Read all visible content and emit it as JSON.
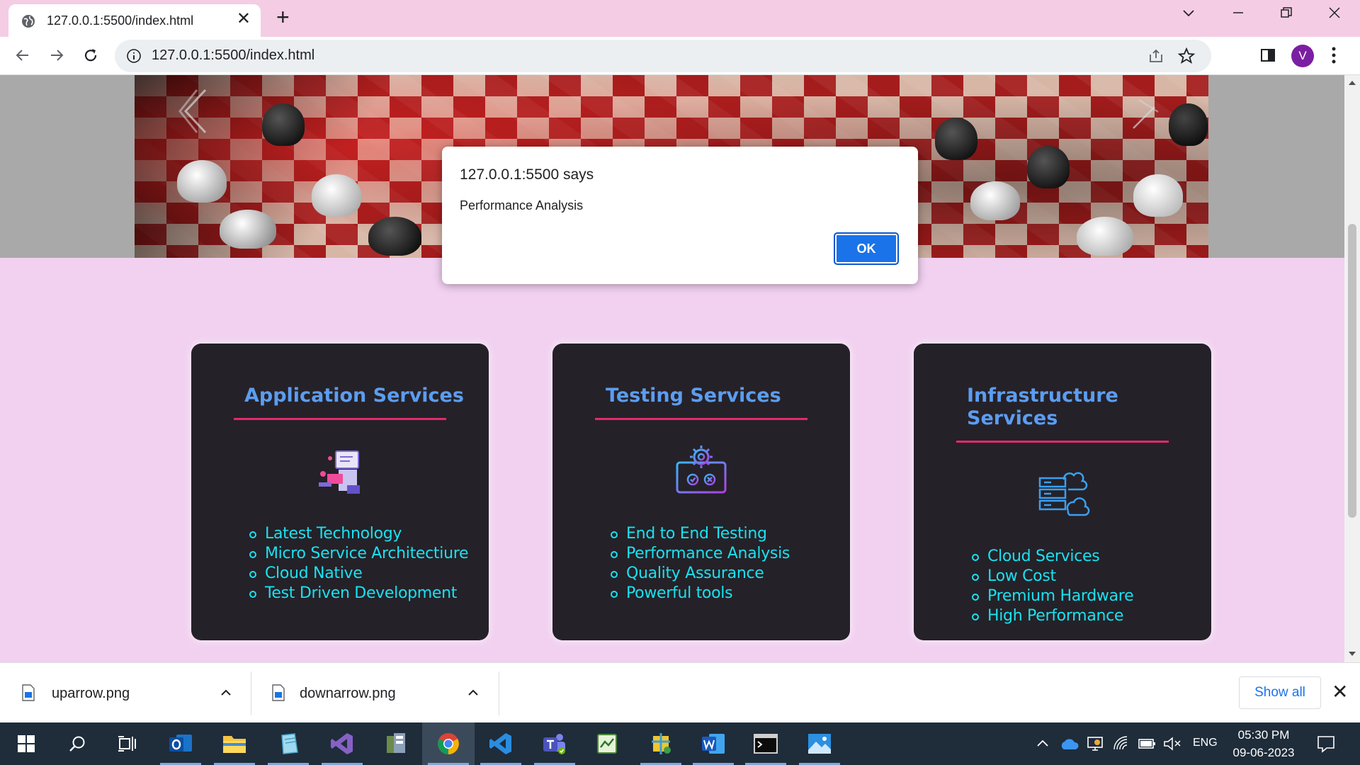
{
  "browser": {
    "tab_title": "127.0.0.1:5500/index.html",
    "url": "127.0.0.1:5500/index.html",
    "avatar_letter": "V"
  },
  "dialog": {
    "title": "127.0.0.1:5500 says",
    "message": "Performance Analysis",
    "ok_label": "OK"
  },
  "cards": [
    {
      "title": "Application Services",
      "icon": "developer-laptop-icon",
      "items": [
        "Latest Technology",
        "Micro Service Architectiure",
        "Cloud Native",
        "Test Driven Development"
      ]
    },
    {
      "title": "Testing Services",
      "icon": "gear-laptop-icon",
      "items": [
        "End to End Testing",
        "Performance Analysis",
        "Quality Assurance",
        "Powerful tools"
      ]
    },
    {
      "title_line1": "Infrastructure",
      "title_line2": "Services",
      "icon": "server-cloud-icon",
      "items": [
        "Cloud Services",
        "Low Cost",
        "Premium Hardware",
        "High Performance"
      ]
    }
  ],
  "downloads": {
    "items": [
      {
        "name": "uparrow.png"
      },
      {
        "name": "downarrow.png"
      }
    ],
    "show_all_label": "Show all"
  },
  "taskbar": {
    "apps": [
      "windows-start-icon",
      "search-icon",
      "task-view-icon",
      "outlook-icon",
      "file-explorer-icon",
      "notepad-icon",
      "visual-studio-icon",
      "app-icon",
      "chrome-icon",
      "vscode-icon",
      "teams-icon",
      "app-icon-2",
      "app-icon-3",
      "word-icon",
      "terminal-icon",
      "photos-icon"
    ],
    "language": "ENG",
    "time": "05:30 PM",
    "date": "09-06-2023"
  },
  "colors": {
    "page_bg": "#f1d0f0",
    "card_bg": "#252128",
    "card_title": "#5b9df0",
    "card_list": "#19e2f0",
    "card_underline": "#e2296e",
    "dialog_button": "#1a73e8"
  }
}
